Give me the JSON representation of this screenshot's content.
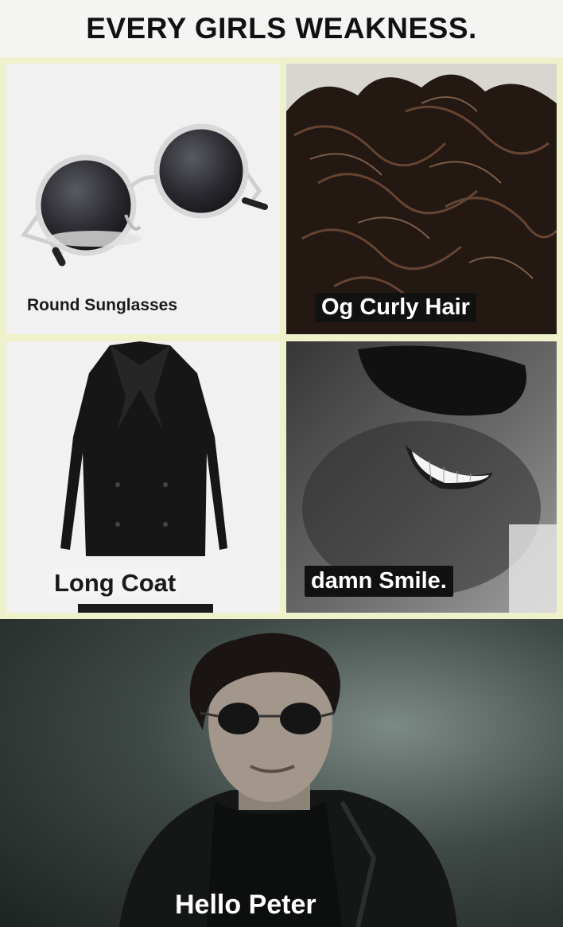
{
  "title": "EVERY GIRLS WEAKNESS.",
  "panels": {
    "sunglasses": {
      "caption": "Round Sunglasses"
    },
    "hair": {
      "caption": "Og Curly Hair"
    },
    "coat": {
      "caption": "Long Coat"
    },
    "smile": {
      "caption": "damn Smile."
    },
    "peter": {
      "caption": "Hello Peter"
    }
  },
  "colors": {
    "background": "#f2f2ef",
    "panel_border": "#eef1c9",
    "caption_box": "#111111",
    "caption_text_light": "#ffffff",
    "caption_text_dark": "#1a1a1a"
  },
  "icons": [
    "round-sunglasses-image",
    "curly-hair-image",
    "long-coat-image",
    "smile-photo",
    "man-portrait-photo"
  ]
}
